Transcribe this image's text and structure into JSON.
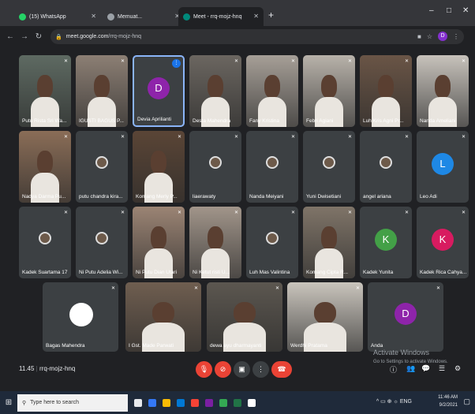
{
  "browser": {
    "tabs": [
      {
        "label": "(15) WhatsApp",
        "color": "#25d366"
      },
      {
        "label": "Memuat...",
        "color": "#9aa0a6"
      },
      {
        "label": "Meet - rrq-mojz-hnq",
        "color": "#00897b"
      }
    ],
    "new_tab": "+",
    "window_controls": [
      "–",
      "□",
      "✕"
    ],
    "url": {
      "host": "meet.google.com",
      "path": "/rrq-mojz-hnq"
    },
    "profile_initial": "D"
  },
  "meet": {
    "tiles": [
      {
        "name": "Putu Rista Sri Wa...",
        "type": "video",
        "bg": "#5e6a62"
      },
      {
        "name": "IGUSTI BAGUS P...",
        "type": "video",
        "bg": "#8c7f74"
      },
      {
        "name": "Devia Aprilianti",
        "type": "avatar",
        "initial": "D",
        "color": "#8e24aa",
        "active": true
      },
      {
        "name": "Desta Mahendra",
        "type": "video",
        "bg": "#6b6660"
      },
      {
        "name": "Fany Kristina",
        "type": "video",
        "bg": "#a69f97"
      },
      {
        "name": "Febri Agiani",
        "type": "video",
        "bg": "#b8b2aa"
      },
      {
        "name": "Luh Kris Agni Pr...",
        "type": "video",
        "bg": "#6a5546"
      },
      {
        "name": "Nanda Ameliani",
        "type": "video",
        "bg": "#c7c2bb"
      },
      {
        "name": "Nadya Darma Pu...",
        "type": "video",
        "bg": "#8a6d57"
      },
      {
        "name": "putu chandra kira...",
        "type": "small",
        "bg": "#3c4043"
      },
      {
        "name": "Komang Merly P...",
        "type": "video",
        "bg": "#5a4536"
      },
      {
        "name": "liaerawaty",
        "type": "small",
        "bg": "#3c4043"
      },
      {
        "name": "Nanda Meiyani",
        "type": "small",
        "bg": "#3c4043"
      },
      {
        "name": "Yuni Dwisetiani",
        "type": "small",
        "bg": "#3c4043"
      },
      {
        "name": "angel ariana",
        "type": "small",
        "bg": "#3c4043"
      },
      {
        "name": "Leo Adi",
        "type": "avatar",
        "initial": "L",
        "color": "#1e88e5"
      },
      {
        "name": "Kadek Suartama 17",
        "type": "small",
        "bg": "#3c4043"
      },
      {
        "name": "Ni Putu Adelia Wi...",
        "type": "small",
        "bg": "#3c4043"
      },
      {
        "name": "Ni Putu Dian Utari",
        "type": "video",
        "bg": "#9b8474"
      },
      {
        "name": "Ni Ketut risti U...",
        "type": "video",
        "bg": "#a1958a"
      },
      {
        "name": "Luh Mas Valintina",
        "type": "small",
        "bg": "#3c4043"
      },
      {
        "name": "Komang Cipta R...",
        "type": "video",
        "bg": "#7f7468"
      },
      {
        "name": "Kadek Yunita",
        "type": "avatar",
        "initial": "K",
        "color": "#43a047"
      },
      {
        "name": "Kadek Rica Cahya...",
        "type": "avatar",
        "initial": "K",
        "color": "#d81b60"
      },
      {
        "name": "Bagas Mahendra",
        "type": "avatar",
        "initial": "",
        "color": "#ffffff"
      },
      {
        "name": "I Gst. Made Parwati",
        "type": "video",
        "bg": "#6f5e50"
      },
      {
        "name": "dewa ayu dharmayanti",
        "type": "video",
        "bg": "#5c5750"
      },
      {
        "name": "Werdhi Pratama",
        "type": "video",
        "bg": "#c9c4bc"
      },
      {
        "name": "Anda",
        "type": "avatar",
        "initial": "D",
        "color": "#8e24aa"
      }
    ],
    "meeting_time": "11.45",
    "meeting_code": "rrq-mojz-hnq",
    "controls": [
      {
        "name": "mic-off-button",
        "glyph": "🎙",
        "color": "#ea4335"
      },
      {
        "name": "camera-off-button",
        "glyph": "⊘",
        "color": "#ea4335"
      },
      {
        "name": "present-button",
        "glyph": "▣",
        "color": "#3c4043"
      },
      {
        "name": "more-options-button",
        "glyph": "⋮",
        "color": "#3c4043"
      },
      {
        "name": "leave-call-button",
        "glyph": "☎",
        "color": "#ea4335"
      }
    ],
    "watermark": {
      "title": "Activate Windows",
      "sub": "Go to Settings to activate Windows."
    },
    "right_buttons": [
      "ⓘ",
      "👥",
      "💬",
      "☰",
      "⚙"
    ]
  },
  "taskbar": {
    "search_placeholder": "Type here to search",
    "app_colors": [
      "#e8eaed",
      "#3478f6",
      "#fbbc05",
      "#0078d4",
      "#f44336",
      "#7b1fa2",
      "#34a853",
      "#217346",
      "#ffffff"
    ],
    "tray_icons": "^ ▭ ⊕ ☼ ENG",
    "time": "11:46 AM",
    "date": "9/2/2021"
  }
}
